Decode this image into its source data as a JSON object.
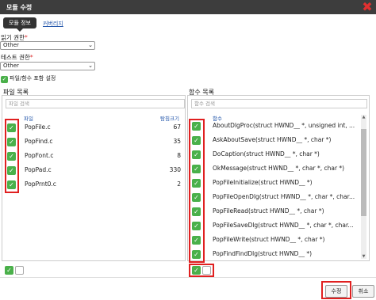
{
  "dialog": {
    "title": "모듈 수정",
    "tabs": {
      "active": "모듈 정보",
      "other": "커버리지"
    },
    "read_permission": {
      "label": "읽기 권한",
      "required": "*",
      "value": "Other"
    },
    "test_permission": {
      "label": "테스트 권한",
      "required": "*",
      "value": "Other"
    },
    "include_setting": {
      "label": "파일/함수 포함 설정",
      "checked": true
    },
    "file_panel": {
      "title": "파일 목록",
      "search_placeholder": "파일 검색",
      "col_file": "파일",
      "col_size": "탐침크기",
      "rows": [
        {
          "name": "PopFile.c",
          "size": "67"
        },
        {
          "name": "PopFind.c",
          "size": "35"
        },
        {
          "name": "PopFont.c",
          "size": "8"
        },
        {
          "name": "PopPad.c",
          "size": "330"
        },
        {
          "name": "PopPrnt0.c",
          "size": "2"
        }
      ]
    },
    "function_panel": {
      "title": "함수 목록",
      "search_placeholder": "함수 검색",
      "col_function": "함수",
      "rows": [
        "AboutDlgProc(struct HWND__ *, unsigned int, ...",
        "AskAboutSave(struct HWND__ *, char *)",
        "DoCaption(struct HWND__ *, char *)",
        "OkMessage(struct HWND__ *, char *, char *)",
        "PopFileInitialize(struct HWND__ *)",
        "PopFileOpenDlg(struct HWND__ *, char *, char...",
        "PopFileRead(struct HWND__ *, char *)",
        "PopFileSaveDlg(struct HWND__ *, char *, char...",
        "PopFileWrite(struct HWND__ *, char *)",
        "PopFindFindDlg(struct HWND__ *)"
      ]
    },
    "buttons": {
      "save": "수정",
      "cancel": "취소"
    },
    "icons": {
      "close": "close-icon",
      "check": "check-icon",
      "dropdown": "chevron-down-icon"
    },
    "colors": {
      "check": "#4ab04a",
      "highlight": "#e02020",
      "titlebar": "#3d3d3d"
    }
  }
}
